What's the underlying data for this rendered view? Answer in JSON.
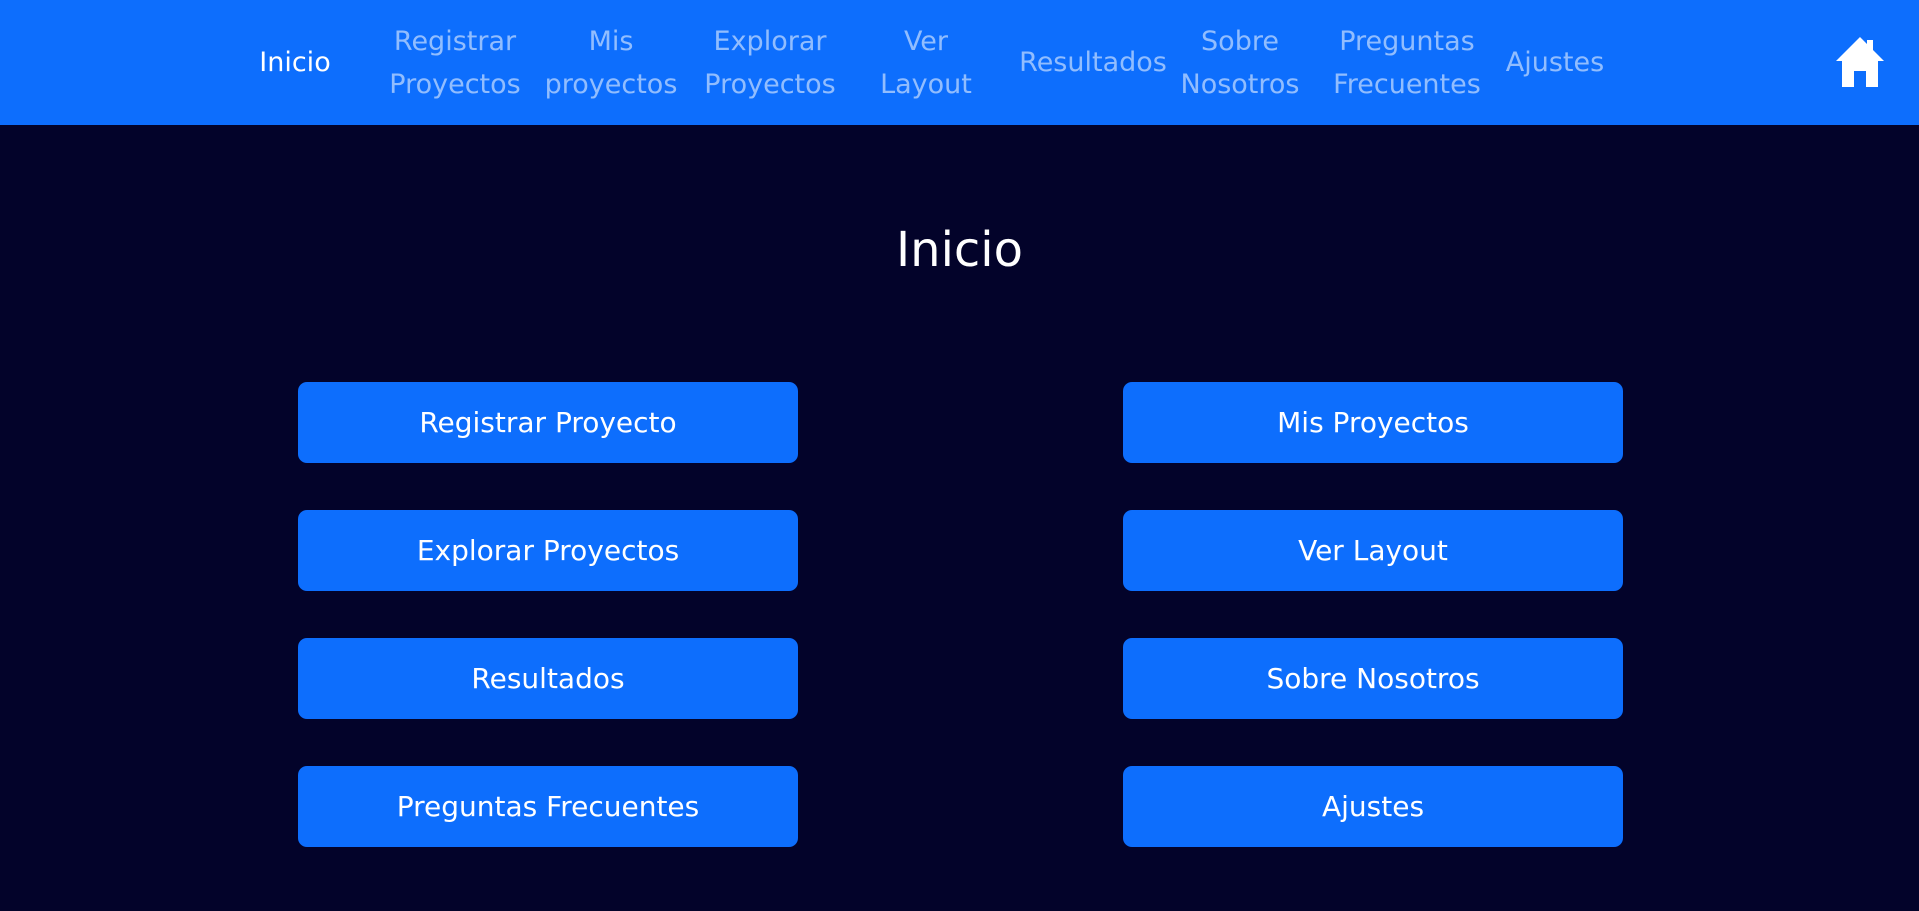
{
  "nav": {
    "links": [
      {
        "label": "Inicio",
        "active": true
      },
      {
        "label": "Registrar\nProyectos",
        "active": false
      },
      {
        "label": "Mis\nproyectos",
        "active": false
      },
      {
        "label": "Explorar\nProyectos",
        "active": false
      },
      {
        "label": "Ver\nLayout",
        "active": false
      },
      {
        "label": "Resultados",
        "active": false
      },
      {
        "label": "Sobre\nNosotros",
        "active": false
      },
      {
        "label": "Preguntas\nFrecuentes",
        "active": false
      },
      {
        "label": "Ajustes",
        "active": false
      }
    ],
    "home_icon": "home-icon"
  },
  "main": {
    "title": "Inicio",
    "buttons": [
      {
        "label": "Registrar Proyecto"
      },
      {
        "label": "Mis Proyectos"
      },
      {
        "label": "Explorar Proyectos"
      },
      {
        "label": "Ver Layout"
      },
      {
        "label": "Resultados"
      },
      {
        "label": "Sobre Nosotros"
      },
      {
        "label": "Preguntas Frecuentes"
      },
      {
        "label": "Ajustes"
      }
    ]
  },
  "colors": {
    "primary": "#0d6efd",
    "background": "#03032a",
    "text": "#ffffff",
    "nav_inactive": "rgba(255,255,255,0.55)"
  }
}
